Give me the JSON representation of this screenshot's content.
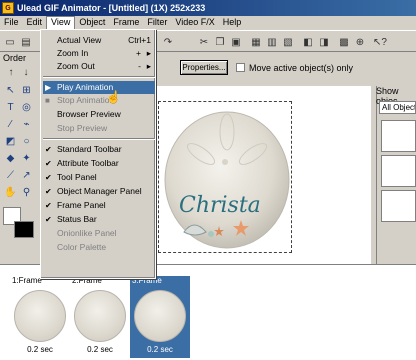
{
  "window": {
    "title": "Ulead GIF Animator - [Untitled] (1X) 252x233"
  },
  "menubar": {
    "items": [
      "File",
      "Edit",
      "View",
      "Object",
      "Frame",
      "Filter",
      "Video F/X",
      "Help"
    ]
  },
  "toolbar": {
    "order_label": "Order",
    "properties_label": "Properties...",
    "move_active_label": "Move active object(s) only"
  },
  "view_menu": {
    "items": [
      {
        "label": "Actual View",
        "shortcut": "Ctrl+1",
        "enabled": true
      },
      {
        "label": "Zoom In",
        "shortcut": "+",
        "submenu": true,
        "enabled": true
      },
      {
        "label": "Zoom Out",
        "shortcut": "-",
        "submenu": true,
        "enabled": true
      },
      {
        "label": "Play Animation",
        "enabled": true,
        "highlighted": true
      },
      {
        "label": "Stop Animation",
        "enabled": false
      },
      {
        "label": "Browser Preview",
        "enabled": true
      },
      {
        "label": "Stop Preview",
        "enabled": false
      },
      {
        "label": "Standard Toolbar",
        "checked": true
      },
      {
        "label": "Attribute Toolbar",
        "checked": true
      },
      {
        "label": "Tool Panel",
        "checked": true
      },
      {
        "label": "Object Manager Panel",
        "checked": true
      },
      {
        "label": "Frame Panel",
        "checked": true
      },
      {
        "label": "Status Bar",
        "checked": true
      },
      {
        "label": "Onionlike Panel",
        "enabled": false
      },
      {
        "label": "Color Palette",
        "enabled": false
      }
    ]
  },
  "object_panel": {
    "label": "Show objec",
    "selector": "All Objects"
  },
  "canvas": {
    "image_text": "Christa"
  },
  "frames": [
    {
      "label": "1:Frame",
      "delay": "0.2 sec",
      "selected": false
    },
    {
      "label": "2:Frame",
      "delay": "0.2 sec",
      "selected": false
    },
    {
      "label": "3:Frame",
      "delay": "0.2 sec",
      "selected": true
    }
  ],
  "colors": {
    "title_start": "#0a246a",
    "title_end": "#3a6ea5",
    "highlight": "#3a6ea5",
    "script_text": "#2a6f80"
  }
}
